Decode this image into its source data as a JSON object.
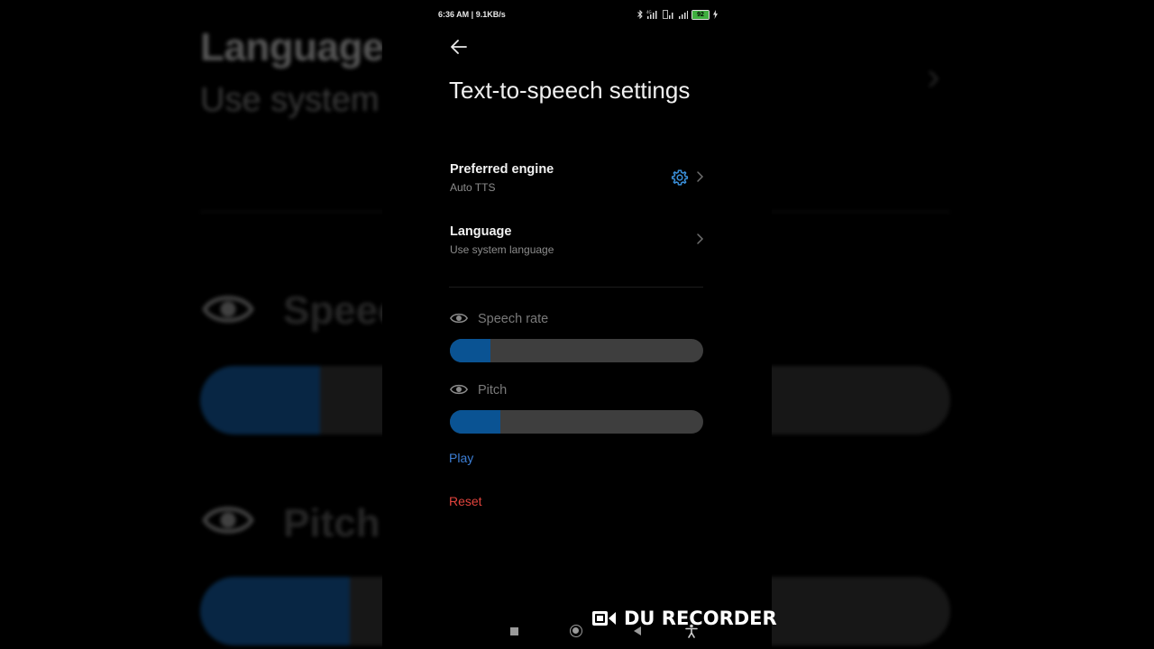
{
  "status_bar": {
    "time_speed": "6:36 AM | 9.1KB/s",
    "battery": "92"
  },
  "header": {
    "title": "Text-to-speech settings"
  },
  "settings": {
    "preferred_engine": {
      "label": "Preferred engine",
      "value": "Auto TTS"
    },
    "language": {
      "label": "Language",
      "value": "Use system language"
    }
  },
  "sliders": {
    "speech_rate": {
      "label": "Speech rate",
      "level": 0.16
    },
    "pitch": {
      "label": "Pitch",
      "level": 0.2
    }
  },
  "actions": {
    "play": "Play",
    "reset": "Reset"
  },
  "watermark": {
    "text": "DU RECORDER"
  },
  "colors": {
    "accent_blue": "#3d7fd6",
    "reset_red": "#e2443d",
    "slider_fill": "#0a5393",
    "slider_track": "#3e3e3e",
    "gear_blue": "#3a8fd9"
  }
}
